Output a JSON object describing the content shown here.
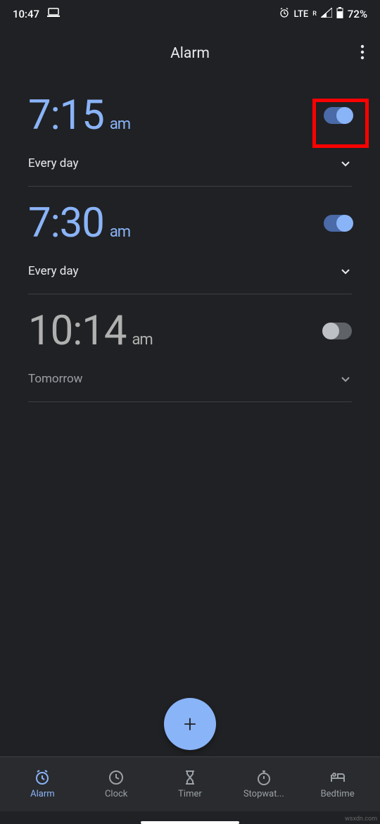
{
  "statusBar": {
    "time": "10:47",
    "network": "LTE",
    "networkSuper": "R",
    "battery": "72%"
  },
  "header": {
    "title": "Alarm"
  },
  "alarms": [
    {
      "time": "7:15",
      "ampm": "am",
      "schedule": "Every day",
      "enabled": true
    },
    {
      "time": "7:30",
      "ampm": "am",
      "schedule": "Every day",
      "enabled": true
    },
    {
      "time": "10:14",
      "ampm": "am",
      "schedule": "Tomorrow",
      "enabled": false
    }
  ],
  "fab": {
    "label": "+"
  },
  "nav": [
    {
      "label": "Alarm",
      "icon": "alarm",
      "active": true
    },
    {
      "label": "Clock",
      "icon": "clock",
      "active": false
    },
    {
      "label": "Timer",
      "icon": "hourglass",
      "active": false
    },
    {
      "label": "Stopwat...",
      "icon": "stopwatch",
      "active": false
    },
    {
      "label": "Bedtime",
      "icon": "bed",
      "active": false
    }
  ],
  "watermark": "wsxdn.com"
}
